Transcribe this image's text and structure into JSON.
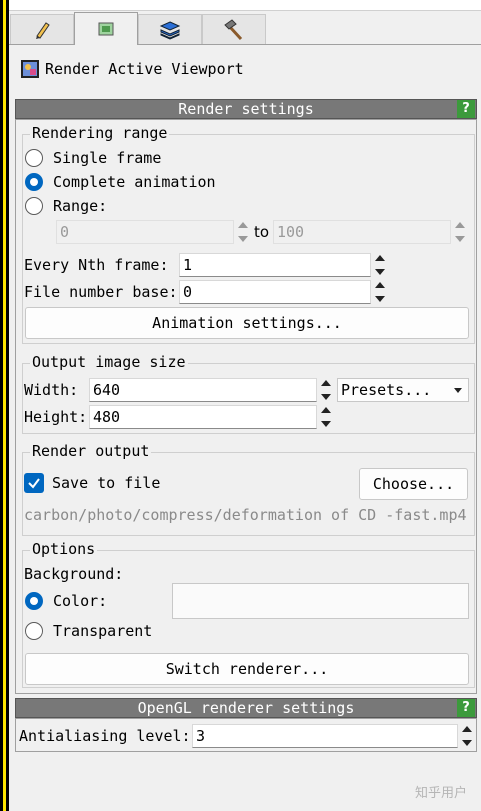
{
  "tabs": [
    {
      "icon": "pencil-icon"
    },
    {
      "icon": "render-frame-icon"
    },
    {
      "icon": "layers-icon"
    },
    {
      "icon": "hammer-icon"
    }
  ],
  "action": {
    "label": "Render Active Viewport",
    "icon": "render-viewport-icon"
  },
  "render_settings": {
    "title": "Render settings",
    "help": "?",
    "rendering_range": {
      "legend": "Rendering range",
      "single_frame": "Single frame",
      "complete_animation": "Complete animation",
      "range": "Range:",
      "selected": "complete_animation",
      "range_start": "0",
      "range_to": "to",
      "range_end": "100",
      "every_nth_label": "Every Nth frame:",
      "every_nth_value": "1",
      "file_number_base_label": "File number base:",
      "file_number_base_value": "0",
      "animation_settings_button": "Animation settings..."
    },
    "output_image_size": {
      "legend": "Output image size",
      "width_label": "Width:",
      "width_value": "640",
      "height_label": "Height:",
      "height_value": "480",
      "presets": "Presets..."
    },
    "render_output": {
      "legend": "Render output",
      "save_to_file": "Save to file",
      "save_checked": true,
      "choose_button": "Choose...",
      "output_path": "carbon/photo/compress/deformation of CD -fast.mp4"
    },
    "options": {
      "legend": "Options",
      "background_label": "Background:",
      "color_label": "Color:",
      "transparent_label": "Transparent",
      "selected": "color",
      "background_color": "#fafafa",
      "switch_renderer_button": "Switch renderer..."
    }
  },
  "opengl_settings": {
    "title": "OpenGL renderer settings",
    "help": "?",
    "antialiasing_label": "Antialiasing level:",
    "antialiasing_value": "3"
  },
  "watermark": "知乎用户",
  "colors": {
    "accent": "#0067c0",
    "header_bg": "#787878",
    "help_bg": "#3c9a3c"
  }
}
